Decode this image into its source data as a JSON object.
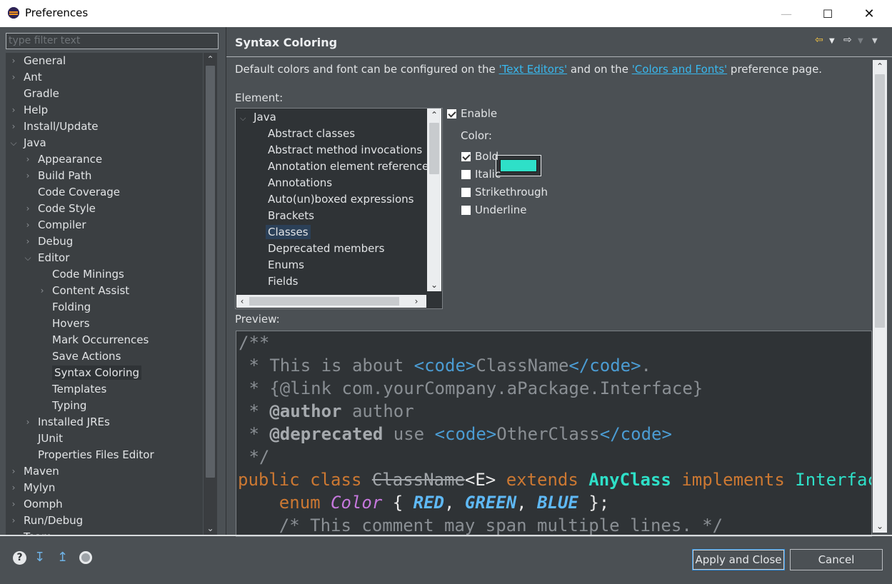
{
  "window": {
    "title": "Preferences"
  },
  "filter": {
    "placeholder": "type filter text"
  },
  "tree": [
    {
      "label": "General",
      "level": 0,
      "expander": "collapsed"
    },
    {
      "label": "Ant",
      "level": 0,
      "expander": "collapsed"
    },
    {
      "label": "Gradle",
      "level": 0,
      "expander": "none"
    },
    {
      "label": "Help",
      "level": 0,
      "expander": "collapsed"
    },
    {
      "label": "Install/Update",
      "level": 0,
      "expander": "collapsed"
    },
    {
      "label": "Java",
      "level": 0,
      "expander": "expanded"
    },
    {
      "label": "Appearance",
      "level": 1,
      "expander": "collapsed"
    },
    {
      "label": "Build Path",
      "level": 1,
      "expander": "collapsed"
    },
    {
      "label": "Code Coverage",
      "level": 1,
      "expander": "none"
    },
    {
      "label": "Code Style",
      "level": 1,
      "expander": "collapsed"
    },
    {
      "label": "Compiler",
      "level": 1,
      "expander": "collapsed"
    },
    {
      "label": "Debug",
      "level": 1,
      "expander": "collapsed"
    },
    {
      "label": "Editor",
      "level": 1,
      "expander": "expanded"
    },
    {
      "label": "Code Minings",
      "level": 2,
      "expander": "none"
    },
    {
      "label": "Content Assist",
      "level": 2,
      "expander": "collapsed"
    },
    {
      "label": "Folding",
      "level": 2,
      "expander": "none"
    },
    {
      "label": "Hovers",
      "level": 2,
      "expander": "none"
    },
    {
      "label": "Mark Occurrences",
      "level": 2,
      "expander": "none"
    },
    {
      "label": "Save Actions",
      "level": 2,
      "expander": "none"
    },
    {
      "label": "Syntax Coloring",
      "level": 2,
      "expander": "none",
      "selected": true
    },
    {
      "label": "Templates",
      "level": 2,
      "expander": "none"
    },
    {
      "label": "Typing",
      "level": 2,
      "expander": "none"
    },
    {
      "label": "Installed JREs",
      "level": 1,
      "expander": "collapsed"
    },
    {
      "label": "JUnit",
      "level": 1,
      "expander": "none"
    },
    {
      "label": "Properties Files Editor",
      "level": 1,
      "expander": "none"
    },
    {
      "label": "Maven",
      "level": 0,
      "expander": "collapsed"
    },
    {
      "label": "Mylyn",
      "level": 0,
      "expander": "collapsed"
    },
    {
      "label": "Oomph",
      "level": 0,
      "expander": "collapsed"
    },
    {
      "label": "Run/Debug",
      "level": 0,
      "expander": "collapsed"
    },
    {
      "label": "Team",
      "level": 0,
      "expander": "collapsed"
    }
  ],
  "page": {
    "title": "Syntax Coloring",
    "desc_prefix": "Default colors and font can be configured on the ",
    "link_text_editors": "'Text Editors'",
    "desc_middle": " and on the ",
    "link_colors_fonts": "'Colors and Fonts'",
    "desc_suffix": " preference page.",
    "element_label": "Element:",
    "preview_label": "Preview:"
  },
  "elements": {
    "root": "Java",
    "items": [
      "Abstract classes",
      "Abstract method invocations",
      "Annotation element reference",
      "Annotations",
      "Auto(un)boxed expressions",
      "Brackets",
      "Classes",
      "Deprecated members",
      "Enums",
      "Fields"
    ],
    "selected": "Classes"
  },
  "options": {
    "enable": {
      "label": "Enable",
      "checked": true
    },
    "color_label": "Color:",
    "color_value": "#2ee0c8",
    "bold": {
      "label": "Bold",
      "checked": true
    },
    "italic": {
      "label": "Italic",
      "checked": false
    },
    "strikethrough": {
      "label": "Strikethrough",
      "checked": false
    },
    "underline": {
      "label": "Underline",
      "checked": false
    }
  },
  "preview": {
    "l1": "/**",
    "l2_a": " * This is about ",
    "l2_tag1": "<code>",
    "l2_cls": "ClassName",
    "l2_tag2": "</code>",
    "l2_end": ".",
    "l3": " * {@link com.yourCompany.aPackage.Interface}",
    "l4_a": " * ",
    "l4_tag": "@author",
    "l4_b": " author",
    "l5_a": " * ",
    "l5_tag": "@deprecated",
    "l5_b": " use ",
    "l5_c1": "<code>",
    "l5_cls": "OtherClass",
    "l5_c2": "</code>",
    "l6": " */",
    "l7_kw1": "public class ",
    "l7_name": "ClassName",
    "l7_gen": "<E> ",
    "l7_kw2": "extends ",
    "l7_cls": "AnyClass",
    "l7_kw3": " implements ",
    "l7_int": "Interface",
    "l8_pre": "    ",
    "l8_kw": "enum ",
    "l8_enum": "Color",
    "l8_a": " { ",
    "l8_c1": "RED",
    "l8_s1": ", ",
    "l8_c2": "GREEN",
    "l8_s2": ", ",
    "l8_c3": "BLUE",
    "l8_end": " };",
    "l9": "    /* This comment may span multiple lines. */"
  },
  "buttons": {
    "apply_close": "Apply and Close",
    "cancel": "Cancel"
  },
  "icons": {
    "help": "help-icon",
    "import": "import-icon",
    "export": "export-icon",
    "oomph": "oomph-record-icon",
    "back": "back-arrow-icon",
    "forward": "forward-arrow-icon"
  }
}
